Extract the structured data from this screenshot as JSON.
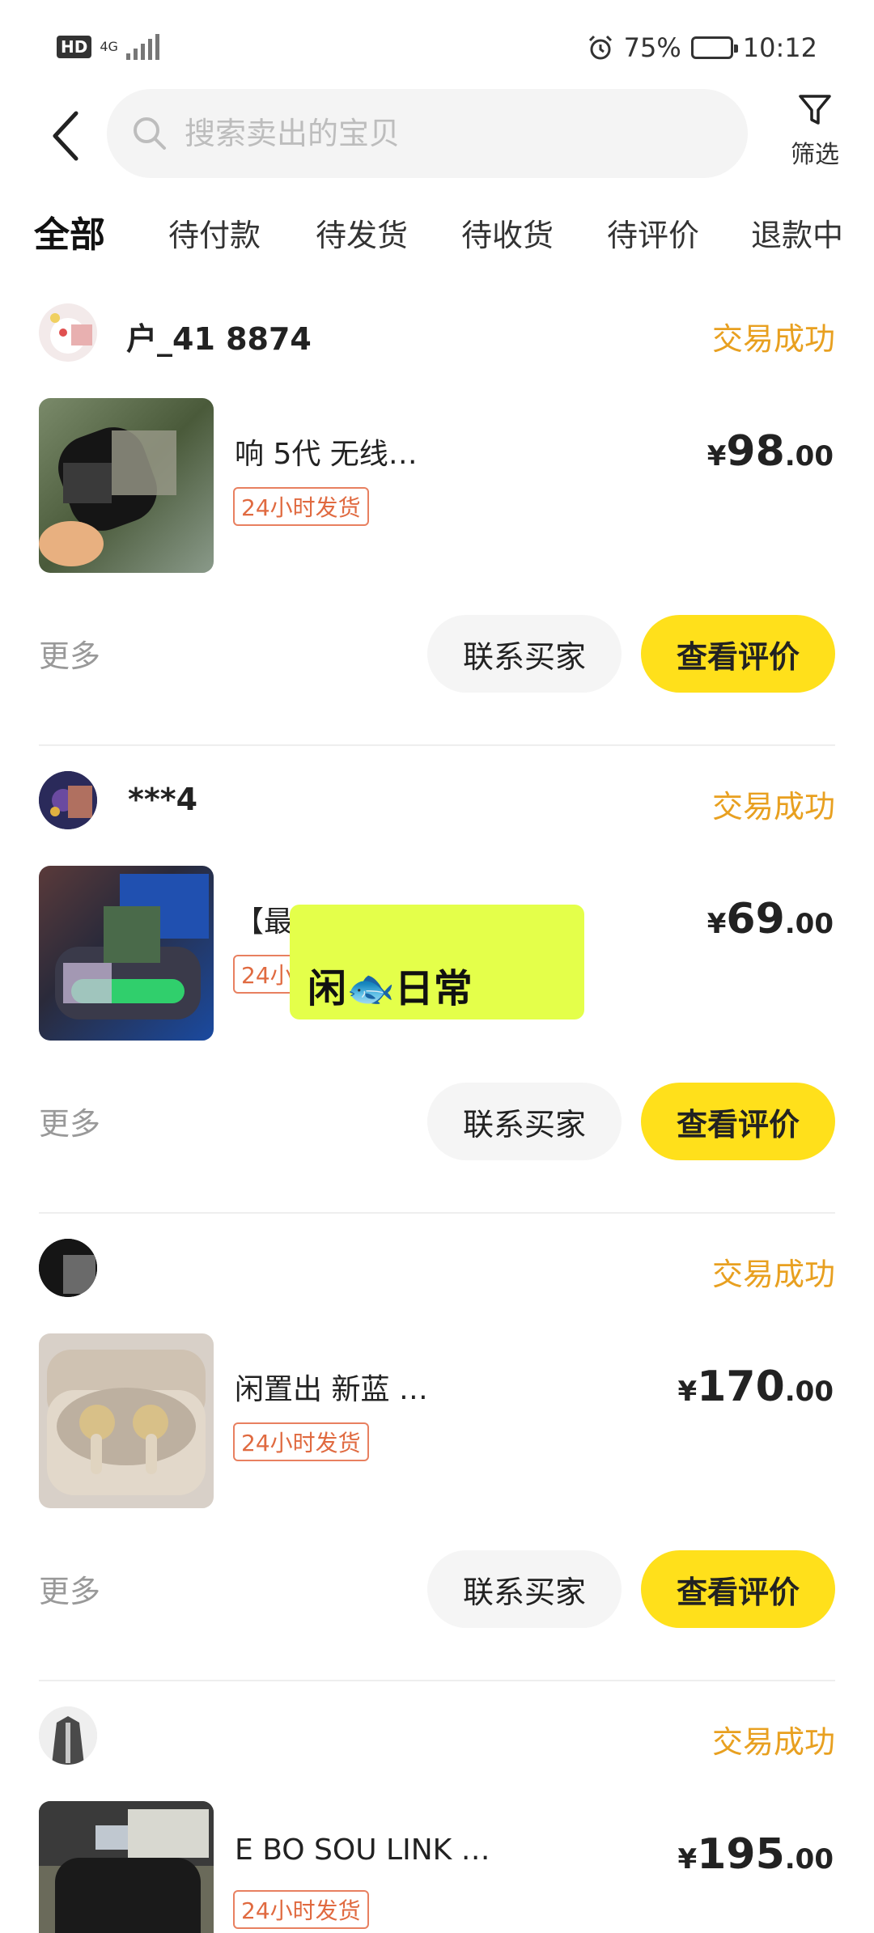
{
  "status_bar": {
    "hd": "HD",
    "network": "4G",
    "battery_percent": "75%",
    "battery_level": 0.75,
    "time": "10:12"
  },
  "header": {
    "search_placeholder": "搜索卖出的宝贝",
    "filter_label": "筛选"
  },
  "tabs": [
    "全部",
    "待付款",
    "待发货",
    "待收货",
    "待评价",
    "退款中"
  ],
  "orders": [
    {
      "buyer": "户_41 8874",
      "status": "交易成功",
      "title": "响 5代 无线…",
      "tag": "24小时发货",
      "price_symbol": "¥",
      "price_int": "98",
      "price_dec": ".00",
      "more": "更多",
      "contact": "联系买家",
      "review": "查看评价"
    },
    {
      "buyer": "***4",
      "status": "交易成功",
      "title": "【最 ! 脉…",
      "tag": "24小",
      "price_symbol": "¥",
      "price_int": "69",
      "price_dec": ".00",
      "more": "更多",
      "contact": "联系买家",
      "review": "查看评价"
    },
    {
      "buyer": "",
      "status": "交易成功",
      "title": "闲置出 新蓝 …",
      "tag": "24小时发货",
      "price_symbol": "¥",
      "price_int": "170",
      "price_dec": ".00",
      "more": "更多",
      "contact": "联系买家",
      "review": "查看评价"
    },
    {
      "buyer": "",
      "status": "交易成功",
      "title": "E BO SOU LINK …",
      "tag": "24小时发货",
      "price_symbol": "¥",
      "price_int": "195",
      "price_dec": ".00"
    }
  ],
  "watermark": {
    "text": "闲🐟日常"
  },
  "colors": {
    "accent_yellow": "#ffe01b",
    "status_orange": "#e8a020",
    "tag_orange": "#e06a40",
    "watermark_bg": "#e4ff4a"
  }
}
